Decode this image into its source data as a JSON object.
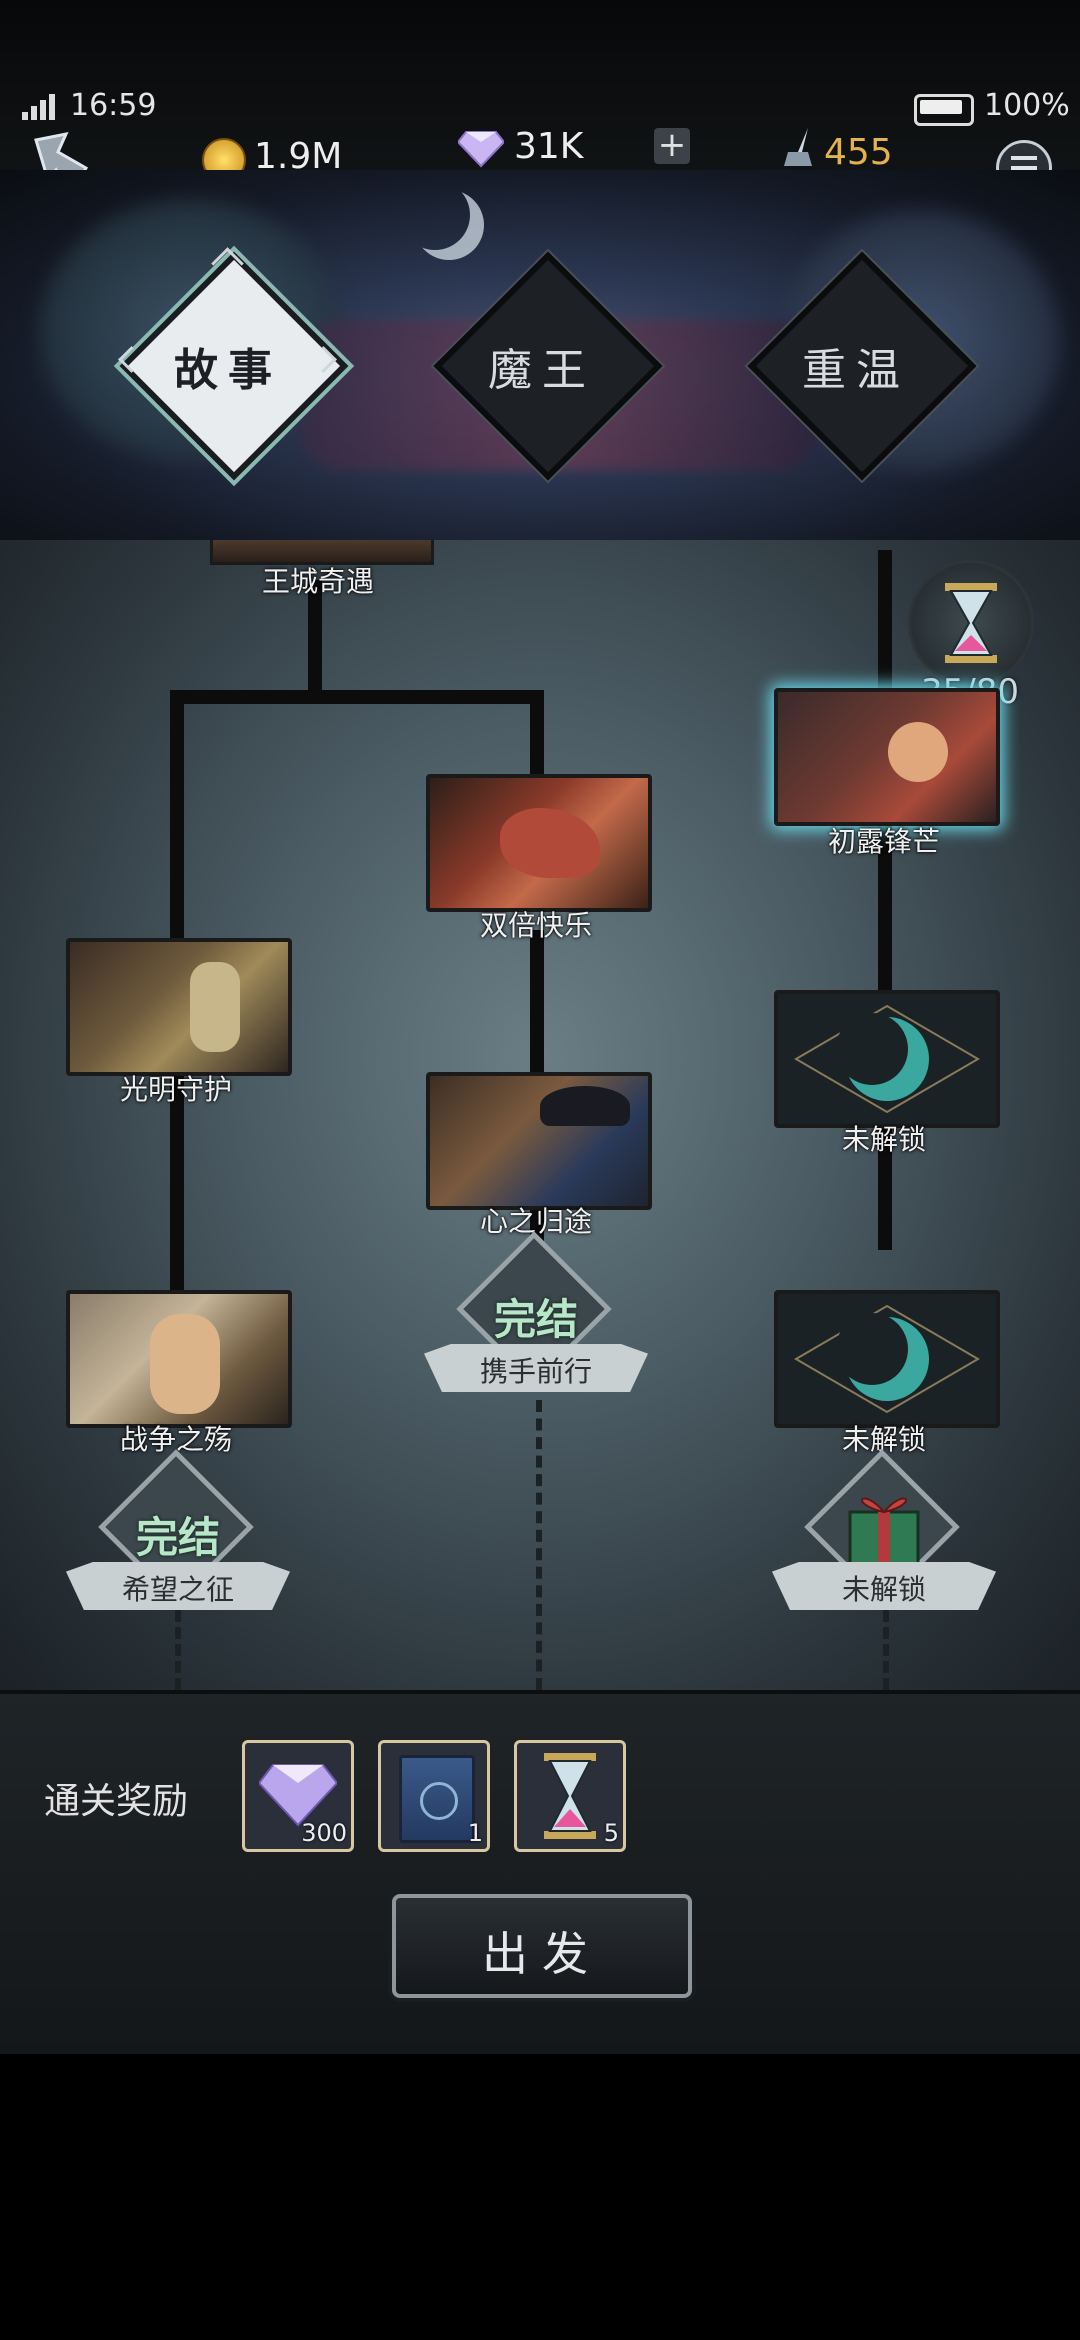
{
  "status_bar": {
    "time": "16:59",
    "battery": "100%"
  },
  "currency": {
    "gold": "1.9M",
    "gems": "31K",
    "ink": "455"
  },
  "tabs": [
    {
      "label": "故事",
      "active": true
    },
    {
      "label": "魔王",
      "active": false
    },
    {
      "label": "重温",
      "active": false
    }
  ],
  "map": {
    "top_node": "王城奇遇",
    "timer_count": "35/80",
    "nodes": {
      "shuangbei": "双倍快乐",
      "guangming": "光明守护",
      "xinzhi": "心之归途",
      "zhanzheng": "战争之殇",
      "chulu": "初露锋芒",
      "locked1": "未解锁",
      "locked2": "未解锁"
    },
    "endings": {
      "left": {
        "badge": "完结",
        "label": "希望之征"
      },
      "center": {
        "badge": "完结",
        "label": "携手前行"
      },
      "right": {
        "label": "未解锁"
      }
    }
  },
  "rewards": {
    "title": "通关奖励",
    "items": [
      {
        "icon": "gem-icon",
        "count": "300"
      },
      {
        "icon": "book-icon",
        "count": "1"
      },
      {
        "icon": "hourglass-icon",
        "count": "5"
      }
    ]
  },
  "start_button": "出发",
  "colors": {
    "ink_gold": "#e3b24a",
    "accent_teal": "#3fa7a0",
    "card_glow": "#67d6e6"
  }
}
